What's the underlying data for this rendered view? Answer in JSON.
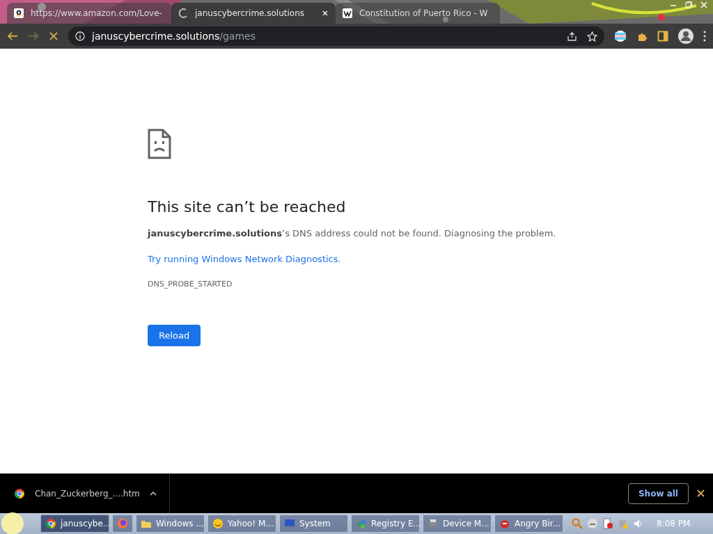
{
  "tabs": [
    {
      "title": "https://www.amazon.com/Love-",
      "selected": false
    },
    {
      "title": "januscybercrime.solutions",
      "selected": true
    },
    {
      "title": "Constitution of Puerto Rico - W",
      "selected": false
    }
  ],
  "toolbar": {
    "url_host": "januscybercrime.solutions",
    "url_path": "/games"
  },
  "error": {
    "title": "This site can’t be reached",
    "message": "**januscybercrime.solutions**’s DNS address could not be found. Diagnosing the problem.",
    "link": "Try running Windows Network Diagnostics",
    "link_suffix": ".",
    "code": "DNS_PROBE_STARTED",
    "button": "Reload"
  },
  "download_bar": {
    "file": "Chan_Zuckerberg_....htm",
    "show_all": "Show all"
  },
  "taskbar": {
    "items": [
      {
        "label": "januscybe...",
        "selected": true
      },
      {
        "selected": false
      },
      {
        "label": "Windows ...",
        "selected": false
      },
      {
        "label": "Yahoo! M...",
        "selected": false
      },
      {
        "label": "System",
        "selected": false
      },
      {
        "label": "Registry E...",
        "selected": false
      },
      {
        "label": "Device M...",
        "selected": false
      },
      {
        "label": "Angry Bir...",
        "selected": false
      }
    ],
    "clock": "8:08 PM"
  }
}
